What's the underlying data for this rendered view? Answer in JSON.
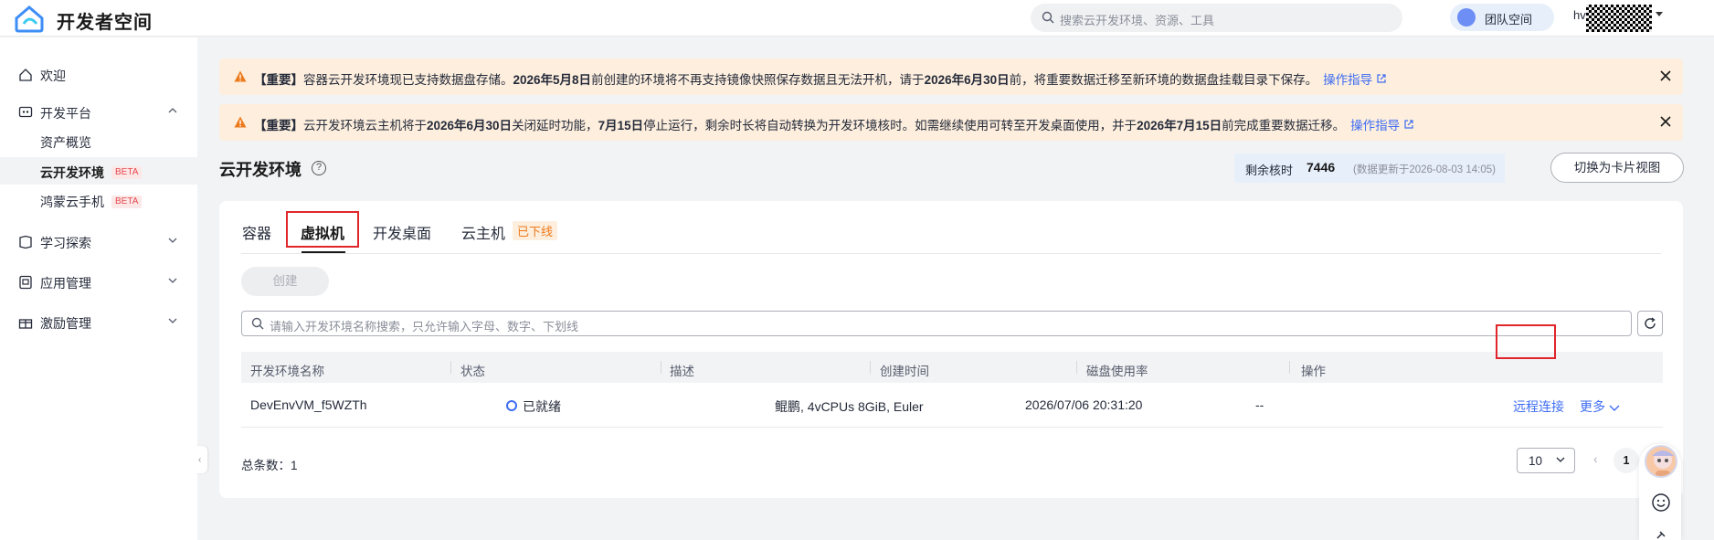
{
  "header": {
    "brand": "开发者空间",
    "search_placeholder": "搜索云开发环境、资源、工具",
    "team_label": "团队空间",
    "user_name": "hv"
  },
  "sidebar": {
    "items": [
      {
        "label": "欢迎",
        "icon": "home-icon"
      },
      {
        "label": "开发平台",
        "icon": "dev-platform-icon",
        "expanded": true
      },
      {
        "label": "资产概览"
      },
      {
        "label": "云开发环境",
        "badge": "BETA",
        "active": true
      },
      {
        "label": "鸿蒙云手机",
        "badge": "BETA"
      },
      {
        "label": "学习探索",
        "icon": "learn-icon"
      },
      {
        "label": "应用管理",
        "icon": "app-icon"
      },
      {
        "label": "激励管理",
        "icon": "gift-icon"
      }
    ]
  },
  "notices": [
    {
      "p1": "【重要】",
      "p2": "容器云开发环境现已支持数据盘存储。",
      "p3": "2026年5月8日",
      "p4": "前创建的环境将不再支持镜像快照保存数据且无法开机，请于",
      "p5": "2026年6月30日",
      "p6": "前，将重要数据迁移至新环境的数据盘挂载目录下保存。",
      "link": "操作指导"
    },
    {
      "p1": "【重要】",
      "p2": "云开发环境云主机将于",
      "p3": "2026年6月30日",
      "p4": "关闭延时功能，",
      "p5": "7月15日",
      "p6": "停止运行，剩余时长将自动转换为开发环境核时。如需继续使用可转至开发桌面使用，并于",
      "p7": "2026年7月15日",
      "p8": "前完成重要数据迁移。",
      "link": "操作指导"
    }
  ],
  "page": {
    "title": "云开发环境",
    "quota_label": "剩余核时",
    "quota_value": "7446",
    "quota_note": "(数据更新于2026-08-03 14:05)",
    "switch_view": "切换为卡片视图"
  },
  "tabs": [
    {
      "label": "容器"
    },
    {
      "label": "虚拟机",
      "active": true
    },
    {
      "label": "开发桌面"
    },
    {
      "label": "云主机",
      "tag": "已下线"
    }
  ],
  "toolbar": {
    "create": "创建",
    "filter_placeholder": "请输入开发环境名称搜索，只允许输入字母、数字、下划线"
  },
  "table": {
    "columns": [
      "开发环境名称",
      "状态",
      "描述",
      "创建时间",
      "磁盘使用率",
      "操作"
    ],
    "rows": [
      {
        "name": "DevEnvVM_f5WZTh",
        "status": "已就绪",
        "desc": "鲲鹏, 4vCPUs 8GiB, Euler",
        "created": "2026/07/06 20:31:20",
        "disk": "--",
        "action_connect": "远程连接",
        "action_more": "更多"
      }
    ]
  },
  "pagination": {
    "total_label": "总条数：1",
    "page_size": "10",
    "current_page": "1"
  },
  "colors": {
    "accent": "#3e6df2",
    "notice_bg": "#fdeedd",
    "warning": "#ed7a1c",
    "highlight_box": "#e0262b"
  }
}
